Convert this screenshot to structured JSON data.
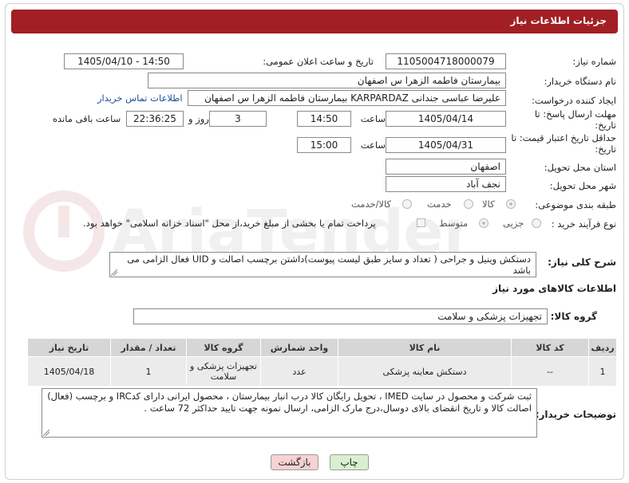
{
  "header": {
    "title": "جزئیات اطلاعات نیاز"
  },
  "fields": {
    "need_number_label": "شماره نیاز:",
    "need_number_value": "1105004718000079",
    "announce_label": "تاریخ و ساعت اعلان عمومی:",
    "announce_value": "1405/04/10 - 14:50",
    "buyer_org_label": "نام دستگاه خریدار:",
    "buyer_org_value": "بیمارستان فاطمه الزهرا س  اصفهان",
    "creator_label": "ایجاد کننده درخواست:",
    "creator_value": "علیرضا عباسی جندانی KARPARDAZ بیمارستان فاطمه الزهرا س  اصفهان",
    "contact_link": "اطلاعات تماس خریدار",
    "reply_deadline_label": "مهلت ارسال پاسخ: تا تاریخ:",
    "reply_date": "1405/04/14",
    "time_label": "ساعت",
    "reply_time": "14:50",
    "days_value": "3",
    "days_label": "روز و",
    "remaining_value": "22:36:25",
    "remaining_label": "ساعت باقی مانده",
    "price_deadline_label": "حداقل تاریخ اعتبار قیمت: تا تاریخ:",
    "price_date": "1405/04/31",
    "price_time_label": "ساعت",
    "price_time": "15:00",
    "province_label": "استان محل تحویل:",
    "province_value": "اصفهان",
    "city_label": "شهر محل تحویل:",
    "city_value": "نجف آباد",
    "category_label": "طبقه بندی موضوعی:",
    "category_options": [
      "کالا",
      "خدمت",
      "کالا/خدمت"
    ],
    "purchase_label": "نوع فرآیند خرید :",
    "purchase_options": [
      "جزیی",
      "متوسط"
    ],
    "payment_text": "پرداخت تمام یا بخشی از مبلغ خرید،از محل \"اسناد خزانه اسلامی\" خواهد بود."
  },
  "description": {
    "label": "شرح کلی نیاز:",
    "text": "دستکش وینیل و جراحی    ( تعداد و سایز طبق لیست پیوست)داشتن برچسب اصالت و UID  فعال الزامی می باشد"
  },
  "goods_section_title": "اطلاعات کالاهای مورد نیاز",
  "goods_group": {
    "label": "گروه کالا:",
    "value": "تجهیزات پزشکی و سلامت"
  },
  "table": {
    "headers": [
      "ردیف",
      "کد کالا",
      "نام کالا",
      "واحد شمارش",
      "گروه کالا",
      "تعداد / مقدار",
      "تاریخ نیاز"
    ],
    "rows": [
      [
        "1",
        "--",
        "دستکش معاینه پزشکی",
        "عدد",
        "تجهیزات پزشکی و سلامت",
        "1",
        "1405/04/18"
      ]
    ]
  },
  "buyer_notes": {
    "label": "توضیحات خریدار:",
    "text": "ثبت شرکت و محصول در سایت IMED ، تحویل رایگان کالا درب انبار بیمارستان ، محصول ایرانی دارای کدIRC و برچسب (فعال) اصالت کالا و تاریخ انقضای بالای دوسال،درج مارک الزامی،  ارسال نمونه جهت تایید حداکثر 72 ساعت ."
  },
  "buttons": {
    "print": "چاپ",
    "back": "بازگشت"
  },
  "colors": {
    "header_bg": "#a21f24",
    "link": "#1a4fa0",
    "back_btn_bg": "#f6d2d2",
    "print_btn_bg": "#d8f0d0"
  },
  "watermark": {
    "text": "AriaTender.neT"
  }
}
